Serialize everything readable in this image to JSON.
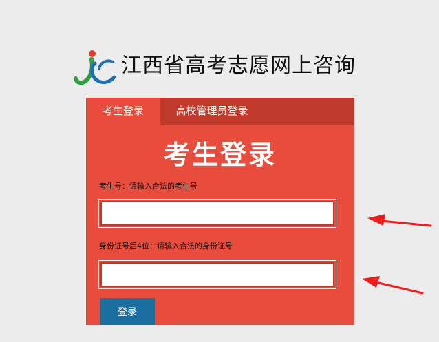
{
  "header": {
    "site_title": "江西省高考志愿网上咨询"
  },
  "tabs": [
    {
      "label": "考生登录",
      "active": true
    },
    {
      "label": "高校管理员登录",
      "active": false
    }
  ],
  "form": {
    "title": "考生登录",
    "student_id_label": "考生号：请输入合法的考生号",
    "id_card_label": "身份证号后4位：请输入合法的身份证号",
    "student_id_value": "",
    "id_card_value": "",
    "login_label": "登录"
  },
  "colors": {
    "panel": "#e74c3c",
    "tab_bar": "#c0392b",
    "button": "#1a6ea0",
    "arrow": "#ee1c1c"
  },
  "icons": {
    "logo": "jc-logo-icon",
    "annotation": "red-arrow-icon"
  }
}
